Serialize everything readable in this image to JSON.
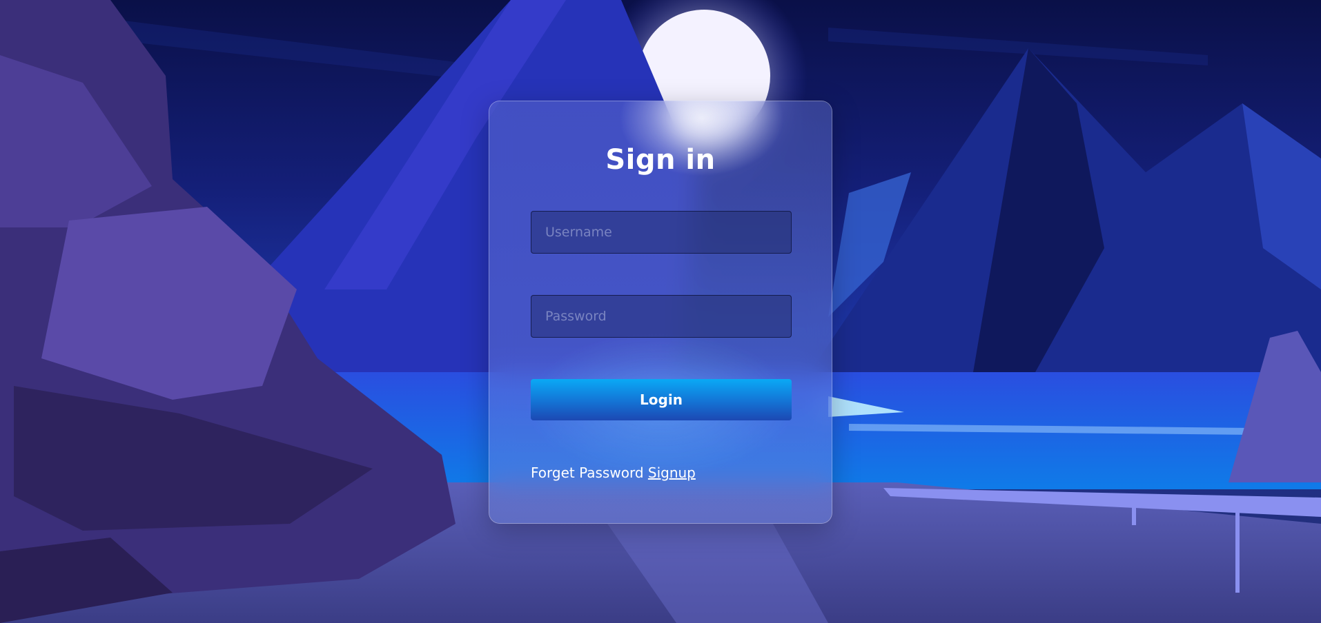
{
  "login_form": {
    "title": "Sign in",
    "username_placeholder": "Username",
    "password_placeholder": "Password",
    "login_label": "Login",
    "forget_password_label": "Forget Password",
    "signup_label": "Signup"
  },
  "colors": {
    "button_top": "#0aa9f5",
    "button_bottom": "#1c48b3",
    "sky": "#141f78"
  }
}
